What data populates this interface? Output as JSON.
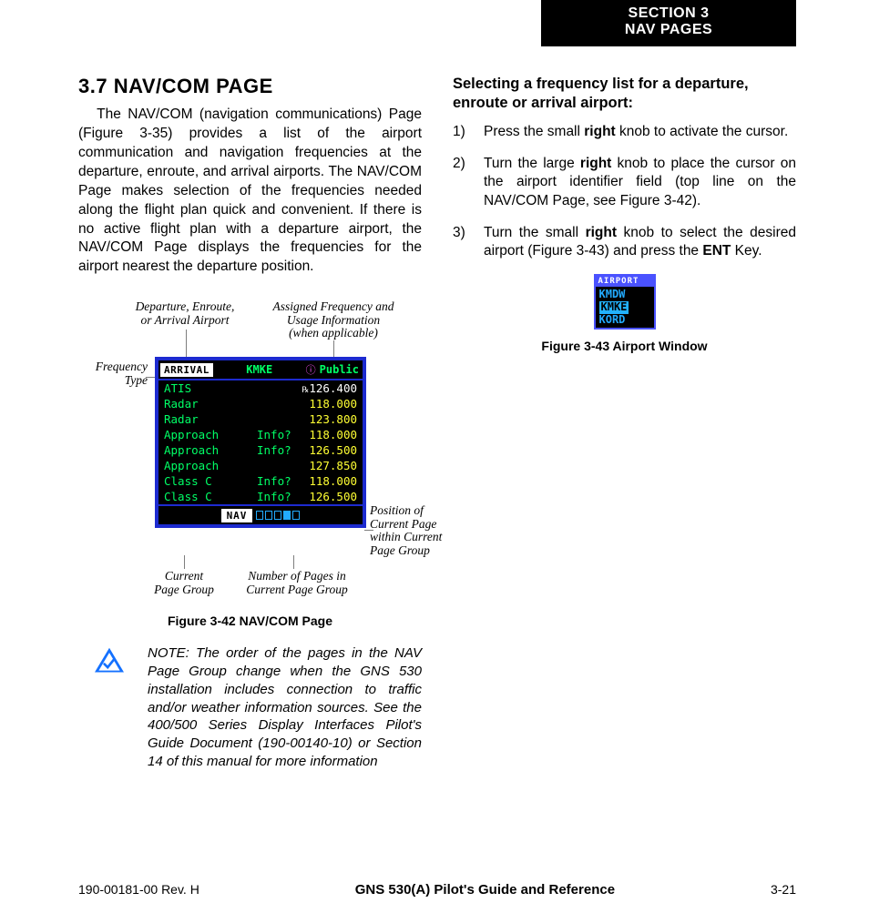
{
  "section_tab": {
    "line1": "SECTION 3",
    "line2": "NAV PAGES"
  },
  "left": {
    "heading": "3.7  NAV/COM PAGE",
    "para": "The NAV/COM (navigation communications) Page (Figure 3-35) provides a list of the airport communication and navigation frequencies at the departure, enroute, and arrival airports.  The NAV/COM Page makes selection of the frequencies needed along the flight plan quick and convenient.  If there is no active flight plan with a departure airport, the NAV/COM Page displays the frequencies for the airport nearest the departure position.",
    "fig42": {
      "annos": {
        "dep_enr": "Departure, Enroute,\nor Arrival Airport",
        "assigned": "Assigned Frequency and\nUsage Information\n(when applicable)",
        "freqtype": "Frequency\nType",
        "position": "Position of\nCurrent Page\nwithin Current\nPage Group",
        "curgroup": "Current\nPage Group",
        "numpages": "Number of Pages in\nCurrent Page Group"
      },
      "header": {
        "arrival": "ARRIVAL",
        "airport": "KMKE",
        "public": "Public"
      },
      "rows": [
        {
          "type": "ATIS",
          "info": "",
          "freq": "126.400",
          "rx": "℞"
        },
        {
          "type": "Radar",
          "info": "",
          "freq": "118.000"
        },
        {
          "type": "Radar",
          "info": "",
          "freq": "123.800"
        },
        {
          "type": "Approach",
          "info": "Info?",
          "freq": "118.000"
        },
        {
          "type": "Approach",
          "info": "Info?",
          "freq": "126.500"
        },
        {
          "type": "Approach",
          "info": "",
          "freq": "127.850"
        },
        {
          "type": "Class C",
          "info": "Info?",
          "freq": "118.000"
        },
        {
          "type": "Class C",
          "info": "Info?",
          "freq": "126.500"
        }
      ],
      "footer": {
        "nav": "NAV"
      },
      "caption": "Figure 3-42  NAV/COM Page"
    },
    "note": "NOTE:  The order of the pages in the NAV Page Group change when the GNS 530 installation includes connection to traffic and/or weather information sources.  See the 400/500 Series Display Interfaces Pilot's Guide Document (190-00140-10) or Section 14 of this manual for more information"
  },
  "right": {
    "subhead": "Selecting a frequency list for a departure, enroute or arrival airport:",
    "steps": {
      "s1a": "Press the small ",
      "s1b": "right",
      "s1c": " knob to activate the cursor.",
      "s2a": "Turn the large ",
      "s2b": "right",
      "s2c": " knob to place the cursor on the airport identifier field (top line on the NAV/COM Page, see Figure 3-42).",
      "s3a": "Turn the small ",
      "s3b": "right",
      "s3c": " knob to select the desired airport (Figure 3-43) and press the ",
      "s3d": "ENT",
      "s3e": " Key."
    },
    "selector": {
      "hdr": "AIRPORT",
      "a": "KMDW",
      "b": "KMKE",
      "c": "KORD"
    },
    "selector_caption": "Figure 3-43 Airport Window"
  },
  "footer": {
    "left": "190-00181-00  Rev. H",
    "mid": "GNS 530(A) Pilot's Guide and Reference",
    "right": "3-21"
  }
}
